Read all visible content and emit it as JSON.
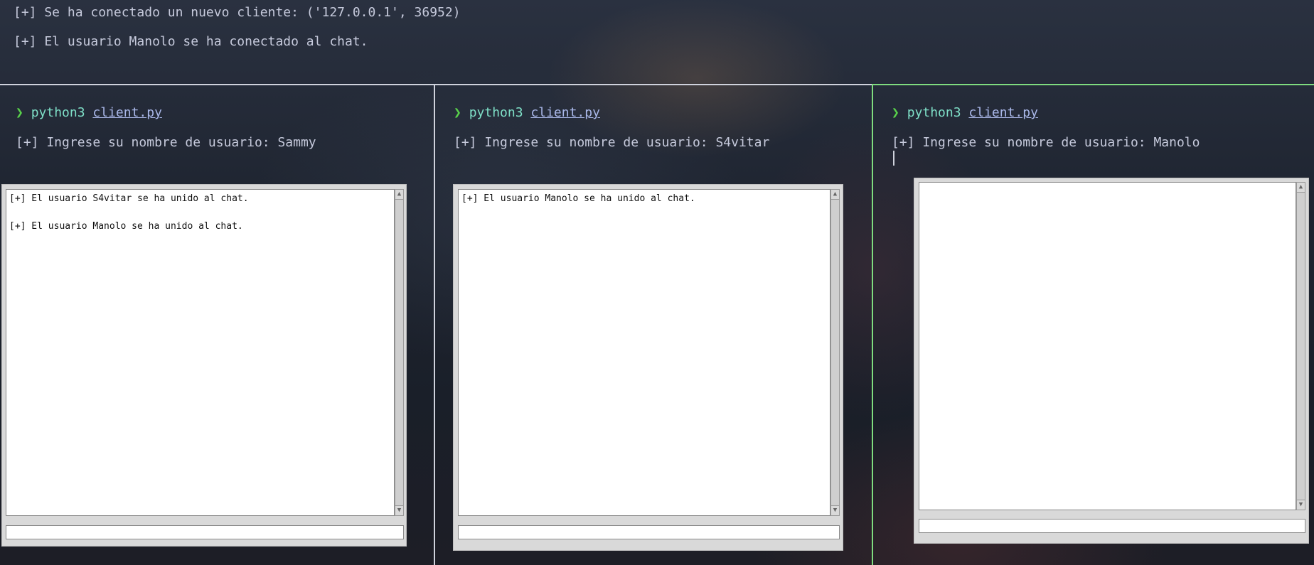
{
  "server": {
    "lines": [
      "[+] Se ha conectado un nuevo cliente: ('127.0.0.1', 36952)",
      "[+] El usuario Manolo se ha conectado al chat."
    ]
  },
  "prompt_symbol": "❯",
  "panes": [
    {
      "command": "python3",
      "file": "client.py",
      "username_prompt": "[+] Ingrese su nombre de usuario: Sammy",
      "chat_messages": [
        "[+] El usuario S4vitar se ha unido al chat.",
        "[+] El usuario Manolo se ha unido al chat."
      ]
    },
    {
      "command": "python3",
      "file": "client.py",
      "username_prompt": "[+] Ingrese su nombre de usuario: S4vitar",
      "chat_messages": [
        "[+] El usuario Manolo se ha unido al chat."
      ]
    },
    {
      "command": "python3",
      "file": "client.py",
      "username_prompt": "[+] Ingrese su nombre de usuario: Manolo",
      "chat_messages": []
    }
  ],
  "scroll_arrows": {
    "up": "▲",
    "down": "▼"
  },
  "colors": {
    "active_pane_border": "#7fdc7f",
    "inactive_pane_border": "#cfd2dc",
    "prompt_arrow": "#59d34b",
    "command": "#7fe0c8"
  }
}
